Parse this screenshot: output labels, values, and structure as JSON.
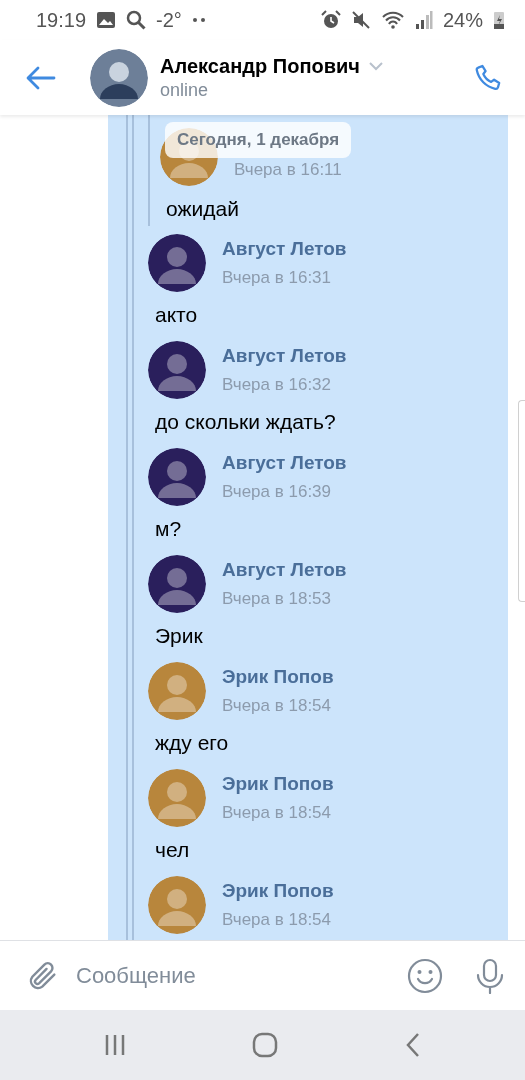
{
  "status_bar": {
    "time": "19:19",
    "temperature": "-2°",
    "battery": "24%"
  },
  "header": {
    "name": "Александр Попович",
    "status": "online"
  },
  "date_pill": "Сегодня, 1 декабря",
  "messages": [
    {
      "kind": "nested",
      "children": [
        {
          "time": "Вчера в 16:11",
          "text": "ожидай",
          "color": "#b8863c"
        }
      ]
    },
    {
      "kind": "message",
      "name": "Август Летов",
      "time": "Вчера в 16:31",
      "text": "акто",
      "color": "#2a1f5c"
    },
    {
      "kind": "message",
      "name": "Август Летов",
      "time": "Вчера в 16:32",
      "text": "до скольки ждать?",
      "color": "#2a1f5c"
    },
    {
      "kind": "message",
      "name": "Август Летов",
      "time": "Вчера в 16:39",
      "text": "м?",
      "color": "#2a1f5c"
    },
    {
      "kind": "message",
      "name": "Август Летов",
      "time": "Вчера в 18:53",
      "text": "Эрик",
      "color": "#2a1f5c"
    },
    {
      "kind": "message",
      "name": "Эрик Попов",
      "time": "Вчера в 18:54",
      "text": "жду его",
      "color": "#b8863c"
    },
    {
      "kind": "message",
      "name": "Эрик Попов",
      "time": "Вчера в 18:54",
      "text": "чел",
      "color": "#b8863c"
    },
    {
      "kind": "message",
      "name": "Эрик Попов",
      "time": "Вчера в 18:54",
      "color": "#b8863c"
    }
  ],
  "composer": {
    "placeholder": "Сообщение"
  }
}
